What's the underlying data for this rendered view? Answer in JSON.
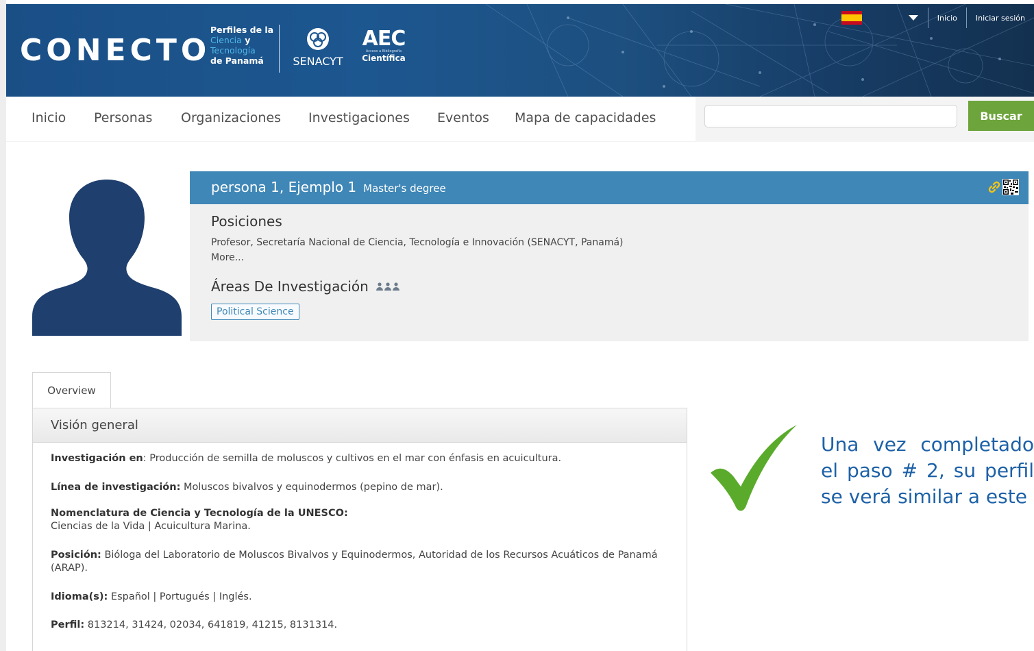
{
  "header": {
    "logo_text": "CONECTO",
    "logo_sub": {
      "line1": "Perfiles de la",
      "line2": "Ciencia",
      "line2b": "y",
      "line3": "Tecnología",
      "line4": "de Panamá"
    },
    "senacyt": "SENACYT",
    "aec": "AEC",
    "aec_tiny": "Acceso a Bibliografía",
    "aec_word": "Científica",
    "top_links": [
      "Inicio",
      "Iniciar sesión"
    ]
  },
  "nav": {
    "items": [
      "Inicio",
      "Personas",
      "Organizaciones",
      "Investigaciones",
      "Eventos",
      "Mapa de capacidades"
    ],
    "search_value": "",
    "search_button": "Buscar"
  },
  "profile": {
    "name": "persona 1, Ejemplo 1",
    "degree": "Master's degree",
    "positions_title": "Posiciones",
    "position": "Profesor, Secretaría Nacional de Ciencia, Tecnología e Innovación (SENACYT, Panamá)",
    "more": "More...",
    "areas_title": "Áreas De Investigación",
    "area_tag": "Political Science"
  },
  "tabs": {
    "overview": "Overview"
  },
  "overview": {
    "title": "Visión general",
    "rows": [
      {
        "label": "Investigación en",
        "sep": ": ",
        "text": "Producción de semilla de moluscos y cultivos en el mar con énfasis en acuicultura."
      },
      {
        "label": "Línea de investigación:",
        "sep": " ",
        "text": "Moluscos bivalvos y equinodermos (pepino de mar)."
      },
      {
        "label": "Nomenclatura de Ciencia y Tecnología de la UNESCO:",
        "sep": "",
        "text": "Ciencias de la Vida | Acuicultura Marina."
      },
      {
        "label": "Posición:",
        "sep": " ",
        "text": "Bióloga del Laboratorio de Moluscos Bivalvos y Equinodermos, Autoridad de los Recursos Acuáticos de Panamá (ARAP)."
      },
      {
        "label": "Idioma(s):",
        "sep": " ",
        "text": "Español | Portugués | Inglés."
      },
      {
        "label": "Perfil:",
        "sep": " ",
        "text": "813214, 31424, 02034, 641819, 41215, 8131314."
      }
    ]
  },
  "callout": "Una vez completado el paso # 2, su perfil se verá similar a este",
  "colors": {
    "header_blue": "#1d5790",
    "profile_blue": "#3f87b7",
    "buscar_green": "#6da43b",
    "check_green": "#5aab2b",
    "callout_blue": "#1d61a7"
  },
  "icons": [
    "link-icon",
    "qr-code-icon",
    "people-icon",
    "checkmark-icon",
    "avatar-silhouette",
    "flag-spain-icon",
    "caret-down-icon"
  ]
}
